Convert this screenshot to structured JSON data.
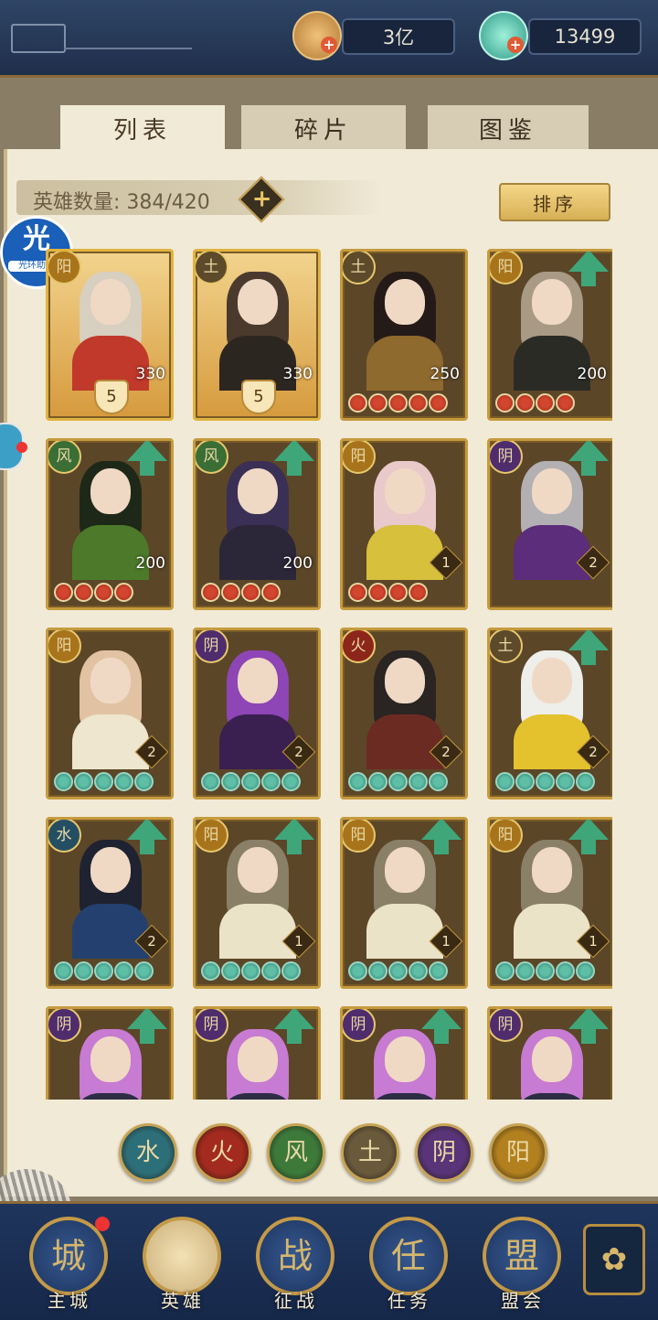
{
  "currency": {
    "coins": "3亿",
    "jade": "13499",
    "plus": "+"
  },
  "tabs": [
    {
      "label": "列表",
      "active": true
    },
    {
      "label": "碎片",
      "active": false
    },
    {
      "label": "图鉴",
      "active": false
    }
  ],
  "hero_count": {
    "label": "英雄数量: 384/420",
    "add": "+"
  },
  "sort_label": "排序",
  "helper_badge": {
    "main": "光",
    "sub": "光环助手"
  },
  "heroes": [
    {
      "element": "阳",
      "level": "330",
      "rank": "5",
      "stars": 0,
      "star_color": "",
      "upgrade": false,
      "gold": true,
      "hair": "#d7cfc0",
      "outfit": "#c0392b"
    },
    {
      "element": "土",
      "level": "330",
      "rank": "5",
      "stars": 0,
      "star_color": "",
      "upgrade": false,
      "gold": true,
      "hair": "#4a3a2e",
      "outfit": "#2c2620"
    },
    {
      "element": "土",
      "level": "250",
      "rank": "",
      "stars": 5,
      "star_color": "red",
      "upgrade": false,
      "gold": false,
      "hair": "#241a18",
      "outfit": "#8f6a2e"
    },
    {
      "element": "阳",
      "level": "200",
      "rank": "",
      "stars": 4,
      "star_color": "red",
      "upgrade": true,
      "gold": false,
      "hair": "#a89a84",
      "outfit": "#2b2b26"
    },
    {
      "element": "风",
      "level": "200",
      "rank": "",
      "stars": 4,
      "star_color": "red",
      "upgrade": true,
      "gold": false,
      "hair": "#1e2818",
      "outfit": "#4d7a2a"
    },
    {
      "element": "风",
      "level": "200",
      "rank": "",
      "stars": 4,
      "star_color": "red",
      "upgrade": true,
      "gold": false,
      "hair": "#3a2f55",
      "outfit": "#2b2638"
    },
    {
      "element": "阳",
      "level": "1",
      "rank": "",
      "stars": 4,
      "star_color": "red",
      "upgrade": false,
      "gold": false,
      "hair": "#e9c9c9",
      "outfit": "#d6c03c"
    },
    {
      "element": "阴",
      "level": "2",
      "rank": "",
      "stars": 0,
      "star_color": "",
      "upgrade": true,
      "gold": false,
      "hair": "#b3b0b3",
      "outfit": "#5b2d7a"
    },
    {
      "element": "阳",
      "level": "2",
      "rank": "",
      "stars": 5,
      "star_color": "green",
      "upgrade": false,
      "gold": false,
      "hair": "#e1c3a3",
      "outfit": "#eee6cf"
    },
    {
      "element": "阴",
      "level": "2",
      "rank": "",
      "stars": 5,
      "star_color": "green",
      "upgrade": false,
      "gold": false,
      "hair": "#8e45b5",
      "outfit": "#3a2050"
    },
    {
      "element": "火",
      "level": "2",
      "rank": "",
      "stars": 5,
      "star_color": "green",
      "upgrade": false,
      "gold": false,
      "hair": "#2a2422",
      "outfit": "#6c2b22"
    },
    {
      "element": "土",
      "level": "2",
      "rank": "",
      "stars": 5,
      "star_color": "green",
      "upgrade": true,
      "gold": false,
      "hair": "#eeeeea",
      "outfit": "#e4c22d"
    },
    {
      "element": "水",
      "level": "2",
      "rank": "",
      "stars": 5,
      "star_color": "green",
      "upgrade": true,
      "gold": false,
      "hair": "#1f2230",
      "outfit": "#23406f"
    },
    {
      "element": "阳",
      "level": "1",
      "rank": "",
      "stars": 5,
      "star_color": "green",
      "upgrade": true,
      "gold": false,
      "hair": "#8a7f67",
      "outfit": "#ebe3c8"
    },
    {
      "element": "阳",
      "level": "1",
      "rank": "",
      "stars": 5,
      "star_color": "green",
      "upgrade": true,
      "gold": false,
      "hair": "#8a7f67",
      "outfit": "#ebe3c8"
    },
    {
      "element": "阳",
      "level": "1",
      "rank": "",
      "stars": 5,
      "star_color": "green",
      "upgrade": true,
      "gold": false,
      "hair": "#8a7f67",
      "outfit": "#ebe3c8"
    },
    {
      "element": "阴",
      "level": "",
      "rank": "",
      "stars": 0,
      "star_color": "",
      "upgrade": true,
      "gold": false,
      "hair": "#c77bd2",
      "outfit": "#2d2d45"
    },
    {
      "element": "阴",
      "level": "",
      "rank": "",
      "stars": 0,
      "star_color": "",
      "upgrade": true,
      "gold": false,
      "hair": "#c77bd2",
      "outfit": "#2d2d45"
    },
    {
      "element": "阴",
      "level": "",
      "rank": "",
      "stars": 0,
      "star_color": "",
      "upgrade": true,
      "gold": false,
      "hair": "#c77bd2",
      "outfit": "#2d2d45"
    },
    {
      "element": "阴",
      "level": "",
      "rank": "",
      "stars": 0,
      "star_color": "",
      "upgrade": true,
      "gold": false,
      "hair": "#c77bd2",
      "outfit": "#2d2d45"
    }
  ],
  "element_filters": [
    {
      "glyph": "水",
      "color": "#2d6f78",
      "name": "water"
    },
    {
      "glyph": "火",
      "color": "#a32a1e",
      "name": "fire"
    },
    {
      "glyph": "风",
      "color": "#3d7a3a",
      "name": "wind"
    },
    {
      "glyph": "土",
      "color": "#6a5a3c",
      "name": "earth"
    },
    {
      "glyph": "阴",
      "color": "#5a3478",
      "name": "yin"
    },
    {
      "glyph": "阳",
      "color": "#b2801e",
      "name": "yang"
    }
  ],
  "nav": [
    {
      "label": "主城",
      "icon": "城",
      "name": "main-city",
      "active": false
    },
    {
      "label": "英雄",
      "icon": "",
      "name": "heroes",
      "active": true
    },
    {
      "label": "征战",
      "icon": "战",
      "name": "campaign",
      "active": false
    },
    {
      "label": "任务",
      "icon": "任",
      "name": "quests",
      "active": false
    },
    {
      "label": "盟会",
      "icon": "盟",
      "name": "alliance",
      "active": false
    }
  ],
  "menu_icon": "✿",
  "colors": {
    "accent_gold": "#c59b3e",
    "upgrade_green": "#3fa67a",
    "nav_blue": "#1f355c"
  }
}
